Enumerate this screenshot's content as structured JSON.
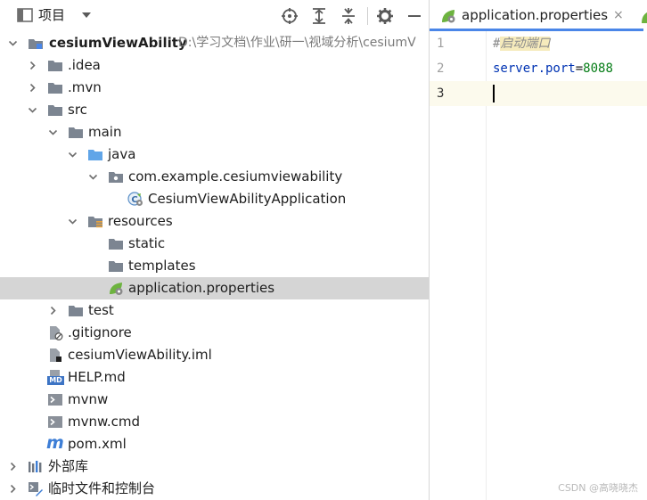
{
  "project_panel": {
    "title": "项目",
    "tree": [
      {
        "label": "cesiumViewAbility",
        "path": "D:\\学习文档\\作业\\研一\\视域分析\\cesiumV",
        "bold": true
      },
      {
        "label": ".idea"
      },
      {
        "label": ".mvn"
      },
      {
        "label": "src"
      },
      {
        "label": "main"
      },
      {
        "label": "java"
      },
      {
        "label": "com.example.cesiumviewability"
      },
      {
        "label": "CesiumViewAbilityApplication"
      },
      {
        "label": "resources"
      },
      {
        "label": "static"
      },
      {
        "label": "templates"
      },
      {
        "label": "application.properties",
        "selected": true
      },
      {
        "label": "test"
      },
      {
        "label": ".gitignore"
      },
      {
        "label": "cesiumViewAbility.iml"
      },
      {
        "label": "HELP.md"
      },
      {
        "label": "mvnw"
      },
      {
        "label": "mvnw.cmd"
      },
      {
        "label": "pom.xml"
      },
      {
        "label": "外部库"
      },
      {
        "label": "临时文件和控制台"
      }
    ],
    "icons": {
      "md_badge": "MD",
      "maven_badge": "m"
    }
  },
  "editor": {
    "tab_label": "application.properties",
    "close_glyph": "×",
    "lines": [
      {
        "number": "1",
        "comment_mark": "#",
        "comment_text": "启动端口"
      },
      {
        "number": "2",
        "key": "server.port",
        "eq": "=",
        "value": "8088"
      },
      {
        "number": "3"
      }
    ]
  },
  "colors": {
    "accent": "#4a86e8",
    "selection": "#d5d5d5",
    "folder": "#7c8591",
    "source_folder": "#60a5e8",
    "spring_green": "#6db33f",
    "key_blue": "#0033b3",
    "value_green": "#067d17"
  },
  "watermark": "CSDN @高晓晓杰"
}
